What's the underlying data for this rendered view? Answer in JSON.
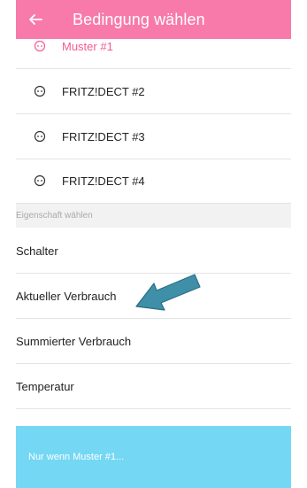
{
  "header": {
    "title": "Bedingung wählen",
    "back_icon": "arrow-left-icon"
  },
  "devices": [
    {
      "label": "Muster #1",
      "selected": true
    },
    {
      "label": "FRITZ!DECT #2",
      "selected": false
    },
    {
      "label": "FRITZ!DECT #3",
      "selected": false
    },
    {
      "label": "FRITZ!DECT #4",
      "selected": false
    }
  ],
  "property_section": {
    "title": "Eigenschaft wählen"
  },
  "properties": [
    {
      "label": "Schalter"
    },
    {
      "label": "Aktueller Verbrauch"
    },
    {
      "label": "Summierter Verbrauch"
    },
    {
      "label": "Temperatur"
    }
  ],
  "footer": {
    "label": "Nur wenn Muster #1..."
  },
  "colors": {
    "header": "#f77aaa",
    "selected_text": "#f55a95",
    "footer": "#74d7f4",
    "annotation_arrow": "#3f8fa8"
  }
}
